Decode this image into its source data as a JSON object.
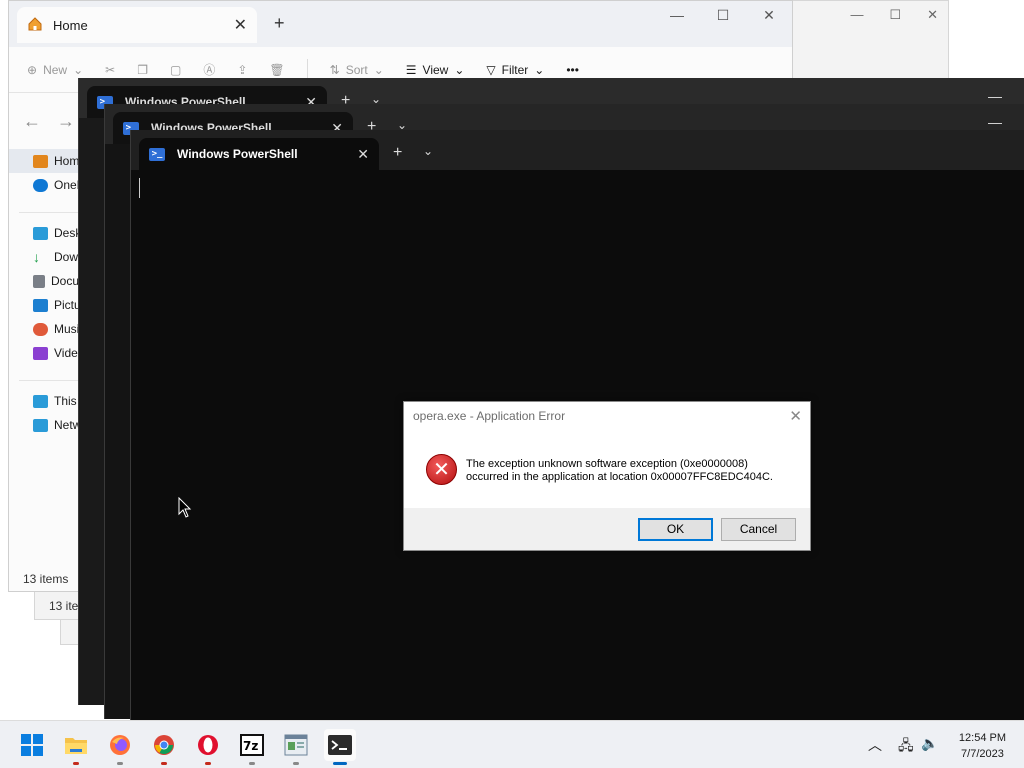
{
  "explorer": {
    "tab_title": "Home",
    "toolbar": {
      "new": "New",
      "sort": "Sort",
      "view": "View",
      "filter": "Filter",
      "more": "•••"
    },
    "sidebar": [
      {
        "label": "Home",
        "icon": "home-icon",
        "color": "#e2861c"
      },
      {
        "label": "OneDrive",
        "icon": "onedrive-icon",
        "color": "#0f78d4"
      },
      {
        "label": "Desktop",
        "icon": "desktop-icon",
        "color": "#2a9bd8"
      },
      {
        "label": "Downloads",
        "icon": "downloads-icon",
        "color": "#1e9f4a"
      },
      {
        "label": "Documents",
        "icon": "documents-icon",
        "color": "#7a7f87"
      },
      {
        "label": "Pictures",
        "icon": "pictures-icon",
        "color": "#1d7fd0"
      },
      {
        "label": "Music",
        "icon": "music-icon",
        "color": "#e05a3a"
      },
      {
        "label": "Videos",
        "icon": "videos-icon",
        "color": "#8b3fd1"
      },
      {
        "label": "This PC",
        "icon": "this-pc-icon",
        "color": "#2a9bd8"
      },
      {
        "label": "Network",
        "icon": "network-icon",
        "color": "#2a9bd8"
      }
    ],
    "status": "13 items",
    "bg_status": "13 items"
  },
  "powershell": {
    "tab_title": "Windows PowerShell"
  },
  "dialog": {
    "title": "opera.exe - Application Error",
    "message_line1": "The exception unknown software exception (0xe0000008)",
    "message_line2": "occurred in the application at location 0x00007FFC8EDC404C.",
    "ok": "OK",
    "cancel": "Cancel"
  },
  "taskbar": {
    "apps": [
      "start",
      "file-explorer",
      "firefox",
      "chrome",
      "opera",
      "7-zip",
      "notepad",
      "terminal"
    ],
    "time": "12:54 PM",
    "date": "7/7/2023"
  },
  "colors": {
    "accent": "#0078d7",
    "error_red": "#c42b1c",
    "terminal_bg": "#0c0c0c"
  }
}
